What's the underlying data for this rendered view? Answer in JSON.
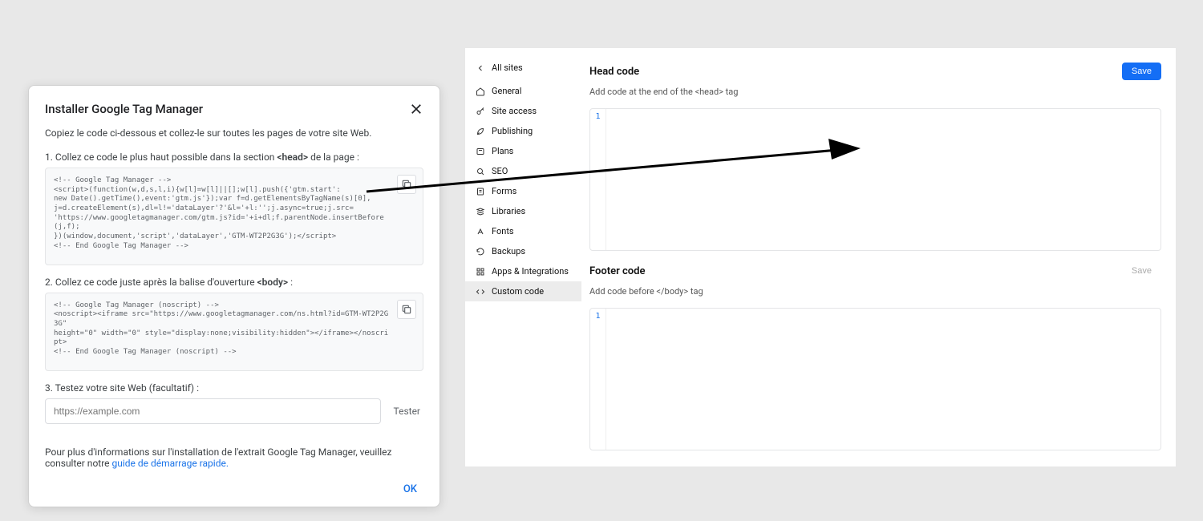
{
  "modal": {
    "title": "Installer Google Tag Manager",
    "desc": "Copiez le code ci-dessous et collez-le sur toutes les pages de votre site Web.",
    "step1_prefix": "1. Collez ce code le plus haut possible dans la section ",
    "step1_bold": "<head>",
    "step1_suffix": " de la page :",
    "code1": "<!-- Google Tag Manager -->\n<script>(function(w,d,s,l,i){w[l]=w[l]||[];w[l].push({'gtm.start':\nnew Date().getTime(),event:'gtm.js'});var f=d.getElementsByTagName(s)[0],\nj=d.createElement(s),dl=l!='dataLayer'?'&l='+l:'';j.async=true;j.src=\n'https://www.googletagmanager.com/gtm.js?id='+i+dl;f.parentNode.insertBefore(j,f);\n})(window,document,'script','dataLayer','GTM-WT2P2G3G');</script>\n<!-- End Google Tag Manager -->",
    "step2_prefix": "2. Collez ce code juste après la balise d'ouverture ",
    "step2_bold": "<body>",
    "step2_suffix": " :",
    "code2": "<!-- Google Tag Manager (noscript) -->\n<noscript><iframe src=\"https://www.googletagmanager.com/ns.html?id=GTM-WT2P2G3G\"\nheight=\"0\" width=\"0\" style=\"display:none;visibility:hidden\"></iframe></noscript>\n<!-- End Google Tag Manager (noscript) -->",
    "step3": "3. Testez votre site Web (facultatif) :",
    "test_placeholder": "https://example.com",
    "tester_label": "Tester",
    "info_prefix": "Pour plus d'informations sur l'installation de l'extrait Google Tag Manager, veuillez consulter notre ",
    "info_link": "guide de démarrage rapide.",
    "ok": "OK"
  },
  "sidebar": {
    "back": "All sites",
    "items": [
      "General",
      "Site access",
      "Publishing",
      "Plans",
      "SEO",
      "Forms",
      "Libraries",
      "Fonts",
      "Backups",
      "Apps & Integrations",
      "Custom code"
    ]
  },
  "content": {
    "head_title": "Head code",
    "head_save": "Save",
    "head_sub": "Add code at the end of the <head> tag",
    "line_no": "1",
    "footer_title": "Footer code",
    "footer_save": "Save",
    "footer_sub": "Add code before </body> tag"
  }
}
